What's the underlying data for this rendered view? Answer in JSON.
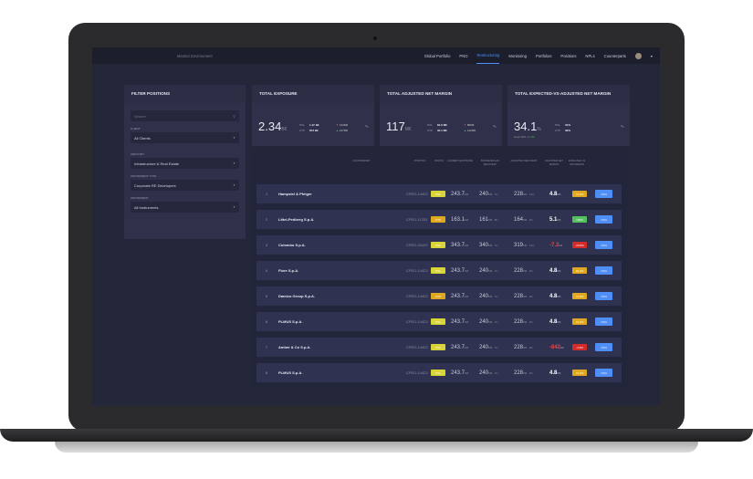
{
  "colors": {
    "accent": "#4f8ef7",
    "pol": "#d8d43a",
    "utp": "#e0a820",
    "orange": "#e0a820",
    "green": "#55c060",
    "red": "#d52a2a"
  },
  "nav": {
    "env": "Monitor Environment",
    "items": [
      "Global Portfolio",
      "PNO",
      "Restructuring",
      "Monitoring",
      "Portfolios",
      "Positions",
      "NPLs",
      "Counterparts"
    ],
    "active": "Restructuring"
  },
  "filter": {
    "title": "FILTER POSITIONS",
    "search_placeholder": "Search",
    "client_label": "CLIENT",
    "client": "All Clients",
    "industry_label": "INDUSTRY",
    "industry": "Infrastructure & Real Estate",
    "type_label": "INSTRUMENT TYPE",
    "type": "Corporate RE Developers",
    "instrument_label": "INSTRUMENT",
    "instrument": "All Instruments"
  },
  "cards": [
    {
      "title": "TOTAL EXPOSURE",
      "value": "2.34",
      "unit": "B€",
      "pol_label": "POL",
      "pol": "1.47 B€",
      "utp_label": "UTP",
      "utp": "873 B€",
      "t1": "134M€",
      "t1_dir": "down",
      "t2": "127M€",
      "t2_dir": "up",
      "sub": ""
    },
    {
      "title": "TOTAL ADJUSTED NET MARGIN",
      "value": "117",
      "unit": "M€",
      "pol_label": "POL",
      "pol": "84.6 M€",
      "utp_label": "UTP",
      "utp": "32.1 M€",
      "t1": "80M€",
      "t1_dir": "down",
      "t2": "142M€",
      "t2_dir": "up",
      "sub": ""
    },
    {
      "title": "TOTAL EXPECTED-VS-ADJUSTED NET MARGIN",
      "value": "34.1",
      "unit": "%",
      "pol_label": "POL",
      "pol": "31%",
      "utp_label": "UTP",
      "utp": "39%",
      "t1": "",
      "t2": "",
      "sub": "Goal 33%",
      "sub_delta": "+1.1%"
    }
  ],
  "table": {
    "headers": [
      "COUNTERPART",
      "POSITION",
      "STATUS",
      "CURRENT EXPOSURE",
      "BUSINESSPLAN RECOVERY",
      "ADJUSTED RECOVERY",
      "ADJUSTED NET MARGIN",
      "EXPECTED VS ADJ MARGIN"
    ],
    "view_label": "VIEW",
    "rows": [
      {
        "n": "1",
        "cp": "Hampstel & Pfeiger",
        "pos": "CPED-14423",
        "status": "POL",
        "exp": "243.7",
        "bp": "240",
        "bpt": "7m",
        "adj": "228",
        "adjt": "13m",
        "margin": "4.8",
        "neg": false,
        "ev": "74.2%",
        "evc": "orange"
      },
      {
        "n": "2",
        "cp": "Littel-Pedberg S.p.A.",
        "pos": "CPED-11203",
        "status": "UTP",
        "exp": "163.1",
        "bp": "161",
        "bpt": "8m",
        "adj": "164",
        "adjt": "9m",
        "margin": "5.1",
        "neg": false,
        "ev": "100%",
        "evc": "green"
      },
      {
        "n": "3",
        "cp": "Colombo S.p.A.",
        "pos": "CPED-43153",
        "status": "POL",
        "exp": "343.7",
        "bp": "340",
        "bpt": "7m",
        "adj": "319",
        "adjt": "13m",
        "margin": "-7.2",
        "neg": true,
        "ev": "-20.8%",
        "evc": "red"
      },
      {
        "n": "4",
        "cp": "Fiore S.p.A.",
        "pos": "CPED-14423",
        "status": "POL",
        "exp": "243.7",
        "bp": "240",
        "bpt": "7m",
        "adj": "228",
        "adjt": "9m",
        "margin": "4.8",
        "neg": false,
        "ev": "34.4%",
        "evc": "orange"
      },
      {
        "n": "5",
        "cp": "Damico Group S.p.A.",
        "pos": "CPED-14423",
        "status": "UTP",
        "exp": "243.7",
        "bp": "240",
        "bpt": "7m",
        "adj": "228",
        "adjt": "9m",
        "margin": "4.8",
        "neg": false,
        "ev": "74.2%",
        "evc": "orange"
      },
      {
        "n": "6",
        "cp": "PLMUS S.p.A.",
        "pos": "CPED-14423",
        "status": "POL",
        "exp": "243.7",
        "bp": "240",
        "bpt": "7m",
        "adj": "228",
        "adjt": "9m",
        "margin": "4.8",
        "neg": false,
        "ev": "74.2%",
        "evc": "orange"
      },
      {
        "n": "7",
        "cp": "Amber & Co S.p.A.",
        "pos": "CPED-14423",
        "status": "POL",
        "exp": "243.7",
        "bp": "240",
        "bpt": "7m",
        "adj": "228",
        "adjt": "9m",
        "margin": "-842",
        "neg": true,
        "ev": "-4.8%",
        "evc": "red"
      },
      {
        "n": "8",
        "cp": "PLMUS S.p.A.",
        "pos": "CPED-14423",
        "status": "POL",
        "exp": "243.7",
        "bp": "240",
        "bpt": "7m",
        "adj": "228",
        "adjt": "9m",
        "margin": "4.8",
        "neg": false,
        "ev": "74.2%",
        "evc": "orange"
      }
    ]
  }
}
